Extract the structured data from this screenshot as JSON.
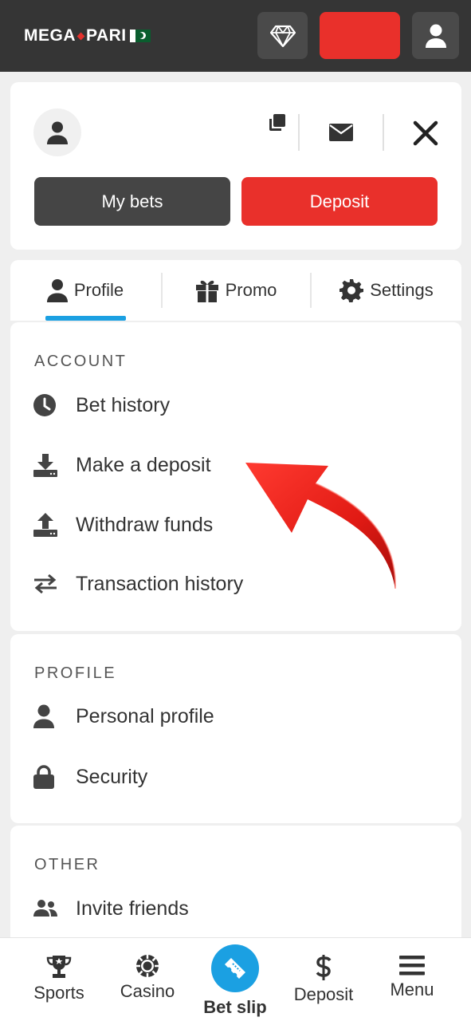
{
  "header": {
    "logo_text": "MEGA PARI"
  },
  "account_card": {
    "my_bets_label": "My bets",
    "deposit_label": "Deposit"
  },
  "tabs": [
    {
      "label": "Profile",
      "icon": "person-icon",
      "active": true
    },
    {
      "label": "Promo",
      "icon": "gift-icon"
    },
    {
      "label": "Settings",
      "icon": "gear-icon"
    }
  ],
  "sections": {
    "account": {
      "title": "ACCOUNT",
      "items": [
        {
          "label": "Bet history",
          "icon": "clock-icon"
        },
        {
          "label": "Make a deposit",
          "icon": "download-icon"
        },
        {
          "label": "Withdraw funds",
          "icon": "upload-icon"
        },
        {
          "label": "Transaction history",
          "icon": "swap-arrows-icon"
        }
      ]
    },
    "profile": {
      "title": "PROFILE",
      "items": [
        {
          "label": "Personal profile",
          "icon": "person-icon"
        },
        {
          "label": "Security",
          "icon": "lock-icon"
        }
      ]
    },
    "other": {
      "title": "OTHER",
      "items": [
        {
          "label": "Invite friends",
          "icon": "people-icon"
        }
      ]
    }
  },
  "bottom_nav": [
    {
      "label": "Sports",
      "icon": "trophy-icon"
    },
    {
      "label": "Casino",
      "icon": "chip-icon"
    },
    {
      "label": "Bet slip",
      "icon": "ticket-icon",
      "highlight": true
    },
    {
      "label": "Deposit",
      "icon": "dollar-icon"
    },
    {
      "label": "Menu",
      "icon": "hamburger-icon"
    }
  ],
  "colors": {
    "accent_red": "#e9302b",
    "accent_blue": "#1ba0e2",
    "header_bg": "#353535",
    "annotation_arrow": "#e8201c"
  }
}
